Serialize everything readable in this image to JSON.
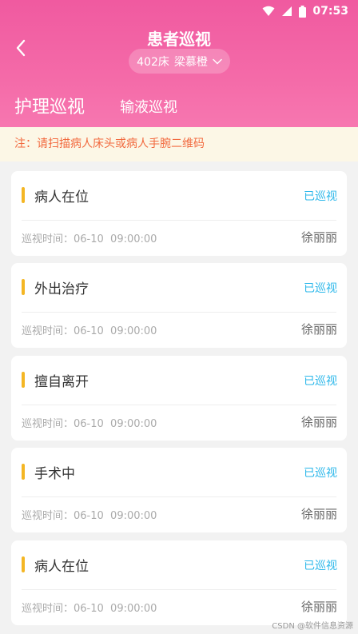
{
  "status_bar": {
    "time": "07:53"
  },
  "header": {
    "title": "患者巡视",
    "bed": {
      "number": "402床",
      "patient": "梁慕橙"
    },
    "tabs": [
      {
        "label": "护理巡视",
        "active": true
      },
      {
        "label": "输液巡视",
        "active": false
      }
    ]
  },
  "notice": "注：请扫描病人床头或病人手腕二维码",
  "records": [
    {
      "state": "病人在位",
      "tag": "已巡视",
      "time_label": "巡视时间：",
      "time": "06-10  09:00:00",
      "nurse": "徐丽丽"
    },
    {
      "state": "外出治疗",
      "tag": "已巡视",
      "time_label": "巡视时间：",
      "time": "06-10  09:00:00",
      "nurse": "徐丽丽"
    },
    {
      "state": "擅自离开",
      "tag": "已巡视",
      "time_label": "巡视时间：",
      "time": "06-10  09:00:00",
      "nurse": "徐丽丽"
    },
    {
      "state": "手术中",
      "tag": "已巡视",
      "time_label": "巡视时间：",
      "time": "06-10  09:00:00",
      "nurse": "徐丽丽"
    },
    {
      "state": "病人在位",
      "tag": "已巡视",
      "time_label": "巡视时间：",
      "time": "06-10  09:00:00",
      "nurse": "徐丽丽"
    }
  ],
  "watermark": "CSDN @软件信息资源",
  "colors": {
    "header": "#f05aa0",
    "accent_tag": "#2ab7ea",
    "marker": "#f4b624",
    "notice_text": "#f26a3f"
  }
}
